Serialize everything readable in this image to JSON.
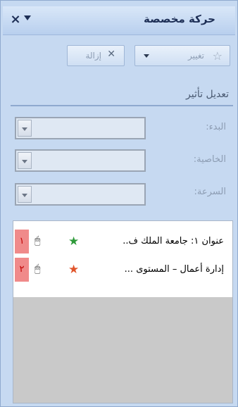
{
  "pane": {
    "title": "حركة مخصصة",
    "close_glyph": "×"
  },
  "toolbar": {
    "change_label": "تغيير",
    "remove_label": "إزالة"
  },
  "modify": {
    "heading": "تعديل تأثير",
    "fields": [
      {
        "label": "البدء:",
        "value": ""
      },
      {
        "label": "الخاصية:",
        "value": ""
      },
      {
        "label": "السرعة:",
        "value": ""
      }
    ]
  },
  "animations": [
    {
      "number": "١",
      "text": "عنوان ١: جامعة الملك ف..",
      "effect_icon": "green-star-effect-icon",
      "trigger_icon": "mouse-click-icon"
    },
    {
      "number": "٢",
      "text": "إدارة أعمال – المستوى ...",
      "effect_icon": "red-star-effect-icon",
      "trigger_icon": "mouse-click-icon"
    }
  ],
  "colors": {
    "pane_bg": "#c6d9f1",
    "number_badge_bg": "#f08a8a",
    "number_text": "#c00000"
  }
}
